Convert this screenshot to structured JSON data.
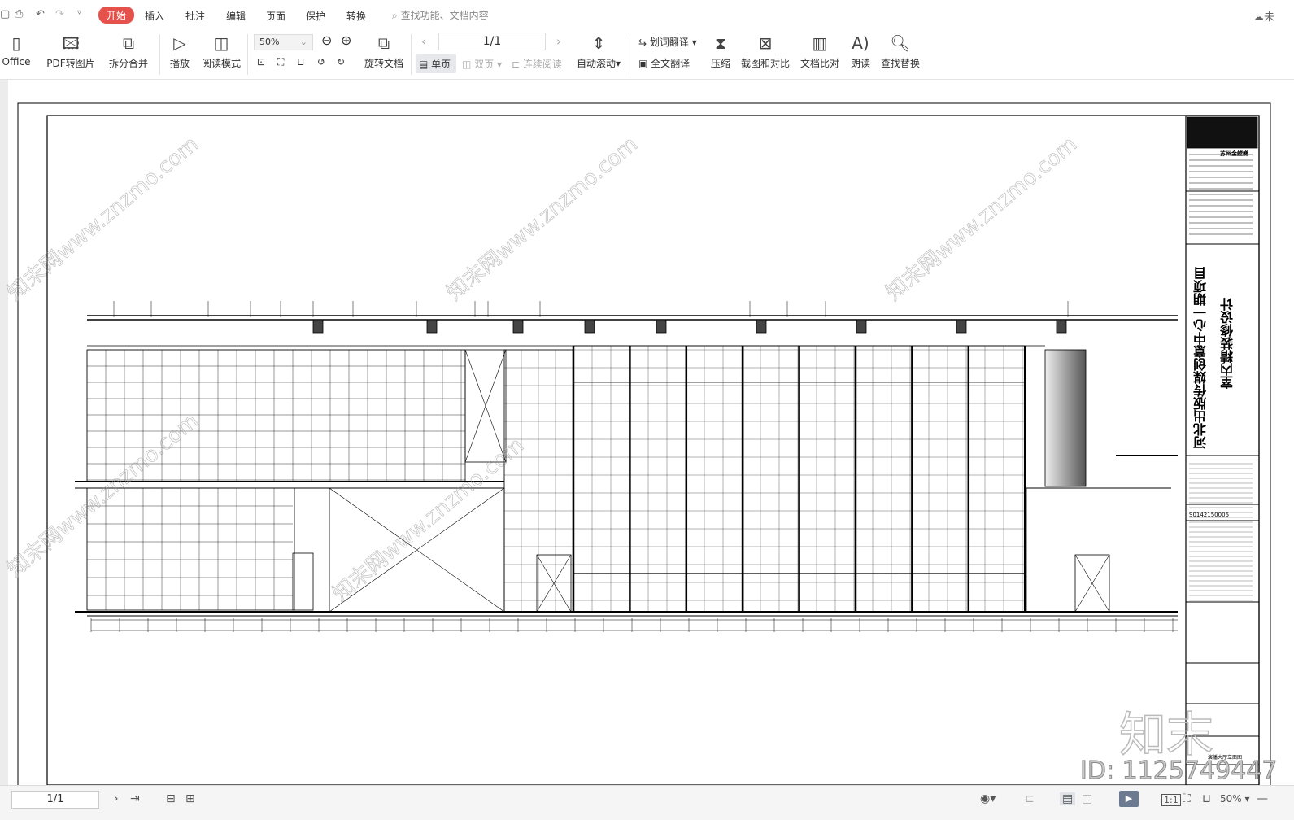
{
  "menubar": {
    "tabs": [
      {
        "label": "开始",
        "active": true
      },
      {
        "label": "插入"
      },
      {
        "label": "批注"
      },
      {
        "label": "编辑"
      },
      {
        "label": "页面"
      },
      {
        "label": "保护"
      },
      {
        "label": "转换"
      }
    ],
    "search_placeholder": "查找功能、文档内容",
    "cloud_label": "未"
  },
  "ribbon": {
    "office": "Office",
    "pdf_to_image": "PDF转图片",
    "split_merge": "拆分合并",
    "play": "播放",
    "read_mode": "阅读模式",
    "zoom_value": "50%",
    "rotate_doc": "旋转文档",
    "page_value": "1/1",
    "single_page": "单页",
    "double_page": "双页",
    "continuous": "连续阅读",
    "auto_scroll": "自动滚动",
    "word_translate": "划词翻译",
    "full_translate": "全文翻译",
    "compress": "压缩",
    "screenshot_compare": "截图和对比",
    "doc_compare": "文档比对",
    "read_aloud": "朗读",
    "find_replace": "查找替换"
  },
  "drawing": {
    "project_title": "河北出版传媒创意中心一期项目",
    "project_subtitle": "室内精装修设计",
    "company": "苏州金螳螂",
    "project_no": "S0142150006",
    "sheet_name": "演播大厅立面图",
    "watermark": "知末网www.znzmo.com",
    "logo_text": "知末",
    "id_text": "ID: 1125749447"
  },
  "status": {
    "page": "1/1",
    "zoom": "50%"
  },
  "colors": {
    "accent": "#e5514b",
    "play": "#6b7a90"
  }
}
